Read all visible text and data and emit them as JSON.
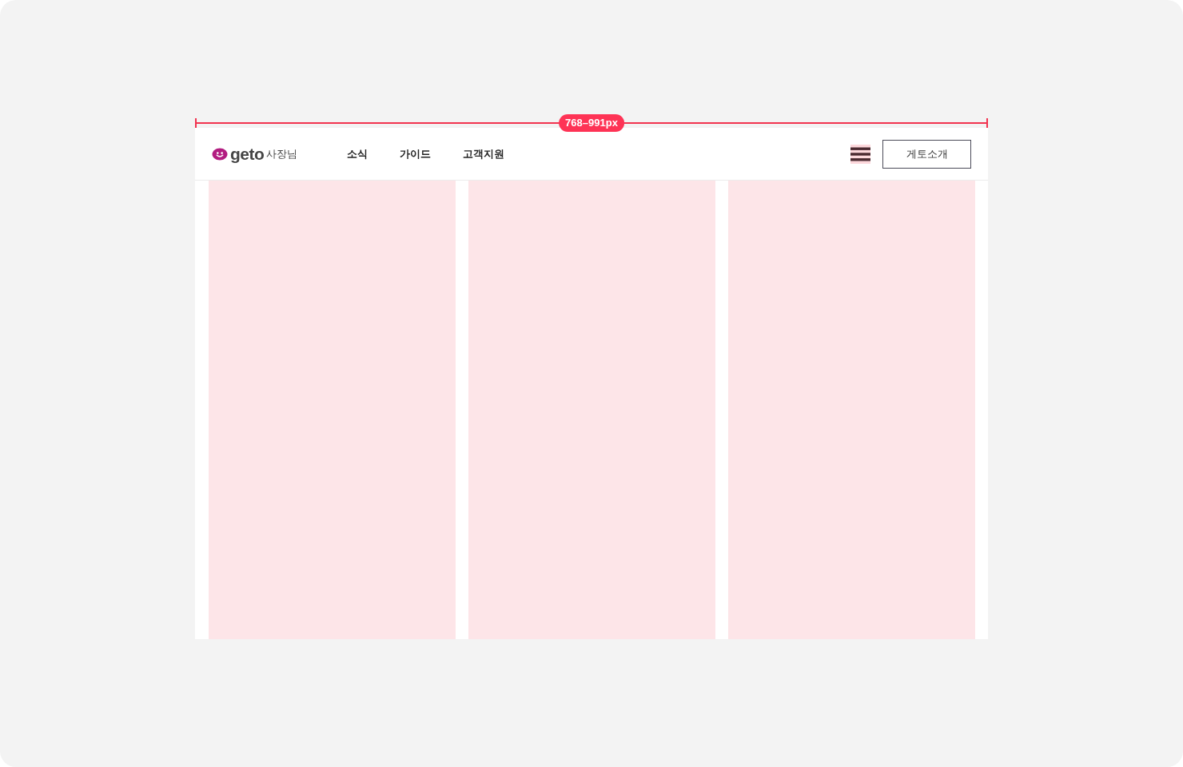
{
  "dimension": {
    "label": "768–991px"
  },
  "header": {
    "logo": {
      "wordmark": "geto",
      "suffix": "사장님"
    },
    "nav": [
      {
        "label": "소식"
      },
      {
        "label": "가이드"
      },
      {
        "label": "고객지원"
      }
    ],
    "cta_button": {
      "label": "게토소개"
    }
  },
  "grid": {
    "columns": [
      {
        "kind": "column"
      },
      {
        "kind": "column"
      },
      {
        "kind": "column"
      }
    ]
  }
}
